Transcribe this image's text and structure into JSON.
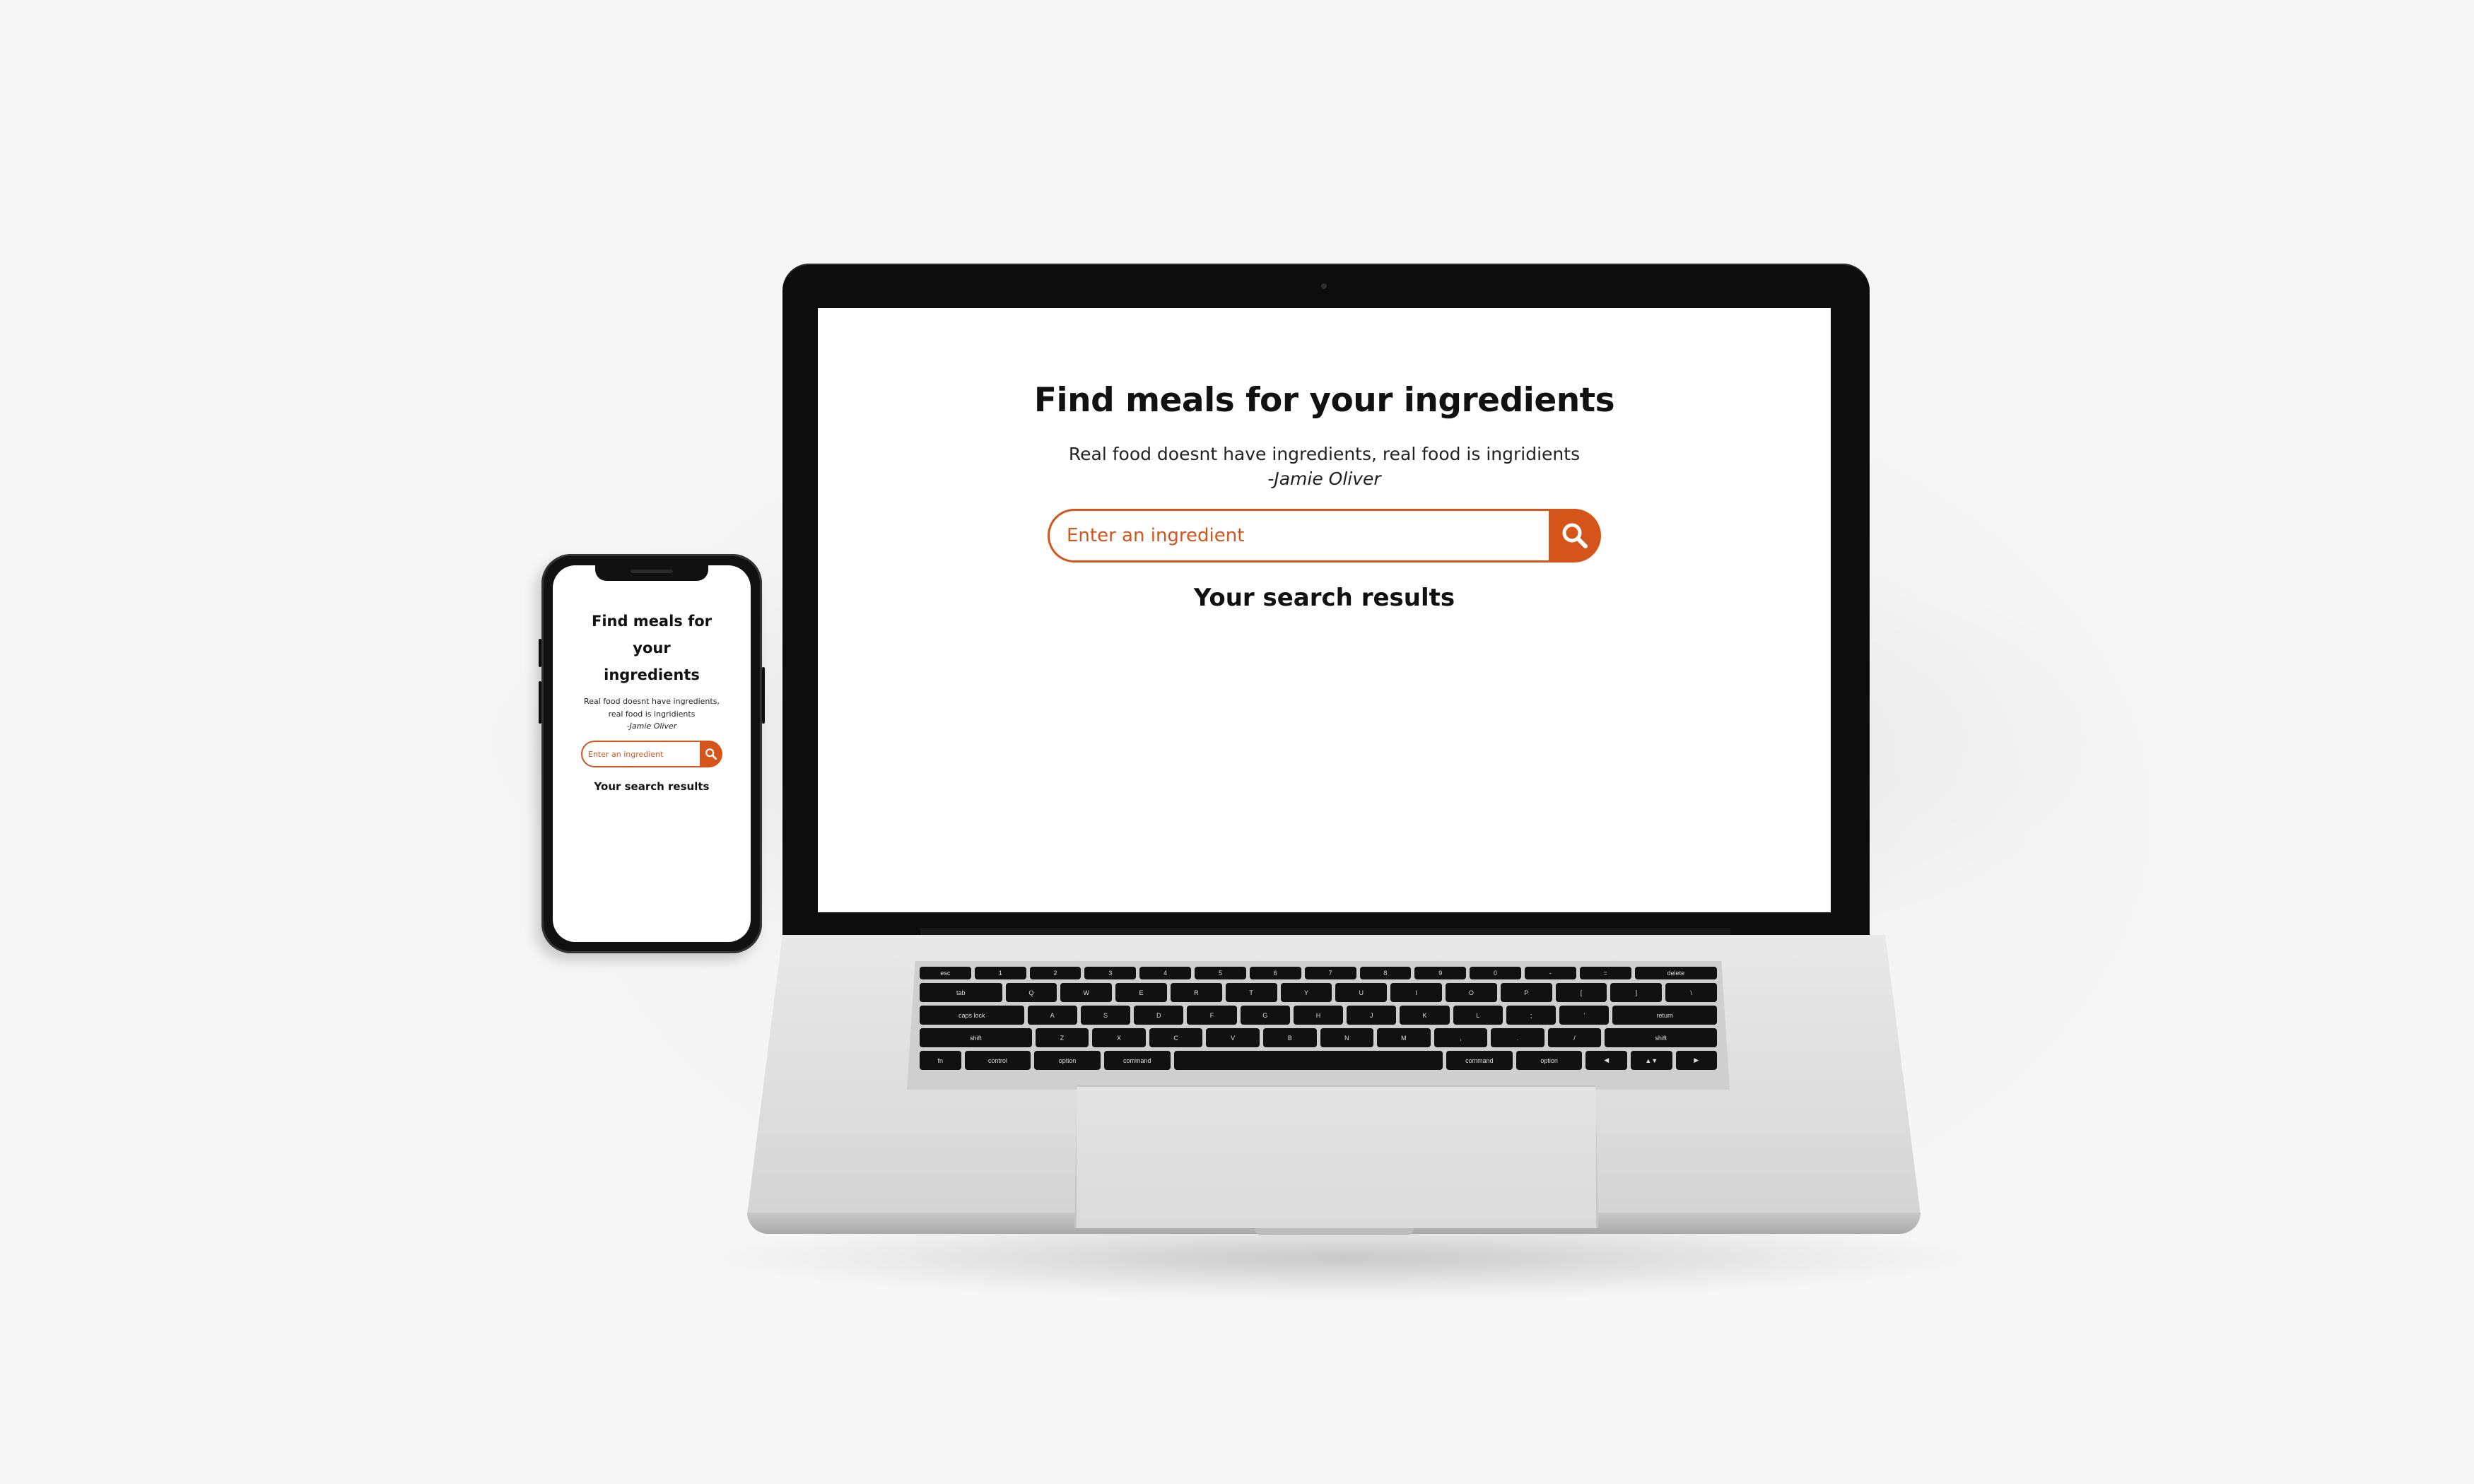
{
  "app": {
    "title": "Find meals for your ingredients",
    "quote": "Real food doesnt have ingredients, real food is ingridients",
    "quote_author": "-Jamie Oliver",
    "search": {
      "placeholder": "Enter an ingredient",
      "button_icon": "search-icon"
    },
    "results_heading": "Your search results"
  },
  "mobile": {
    "title": "Find meals for your ingredients",
    "quote": "Real food doesnt have ingredients, real food is ingridients",
    "quote_author": "-Jamie Oliver",
    "search": {
      "placeholder": "Enter an ingredient"
    },
    "results_heading": "Your search results"
  },
  "keyboard": {
    "rows": [
      [
        "esc",
        "1",
        "2",
        "3",
        "4",
        "5",
        "6",
        "7",
        "8",
        "9",
        "0",
        "-",
        "=",
        "delete"
      ],
      [
        "tab",
        "Q",
        "W",
        "E",
        "R",
        "T",
        "Y",
        "U",
        "I",
        "O",
        "P",
        "[",
        "]",
        "\\"
      ],
      [
        "caps lock",
        "A",
        "S",
        "D",
        "F",
        "G",
        "H",
        "J",
        "K",
        "L",
        ";",
        "'",
        "return"
      ],
      [
        "shift",
        "Z",
        "X",
        "C",
        "V",
        "B",
        "N",
        "M",
        ",",
        ".",
        "/",
        "shift"
      ],
      [
        "fn",
        "control",
        "option",
        "command",
        "",
        "command",
        "option",
        "◀",
        "▲▼",
        "▶"
      ]
    ]
  },
  "colors": {
    "accent": "#d4541a",
    "background": "#f5f5f5",
    "device_frame": "#111111",
    "laptop_body": "#dcdcdd"
  }
}
